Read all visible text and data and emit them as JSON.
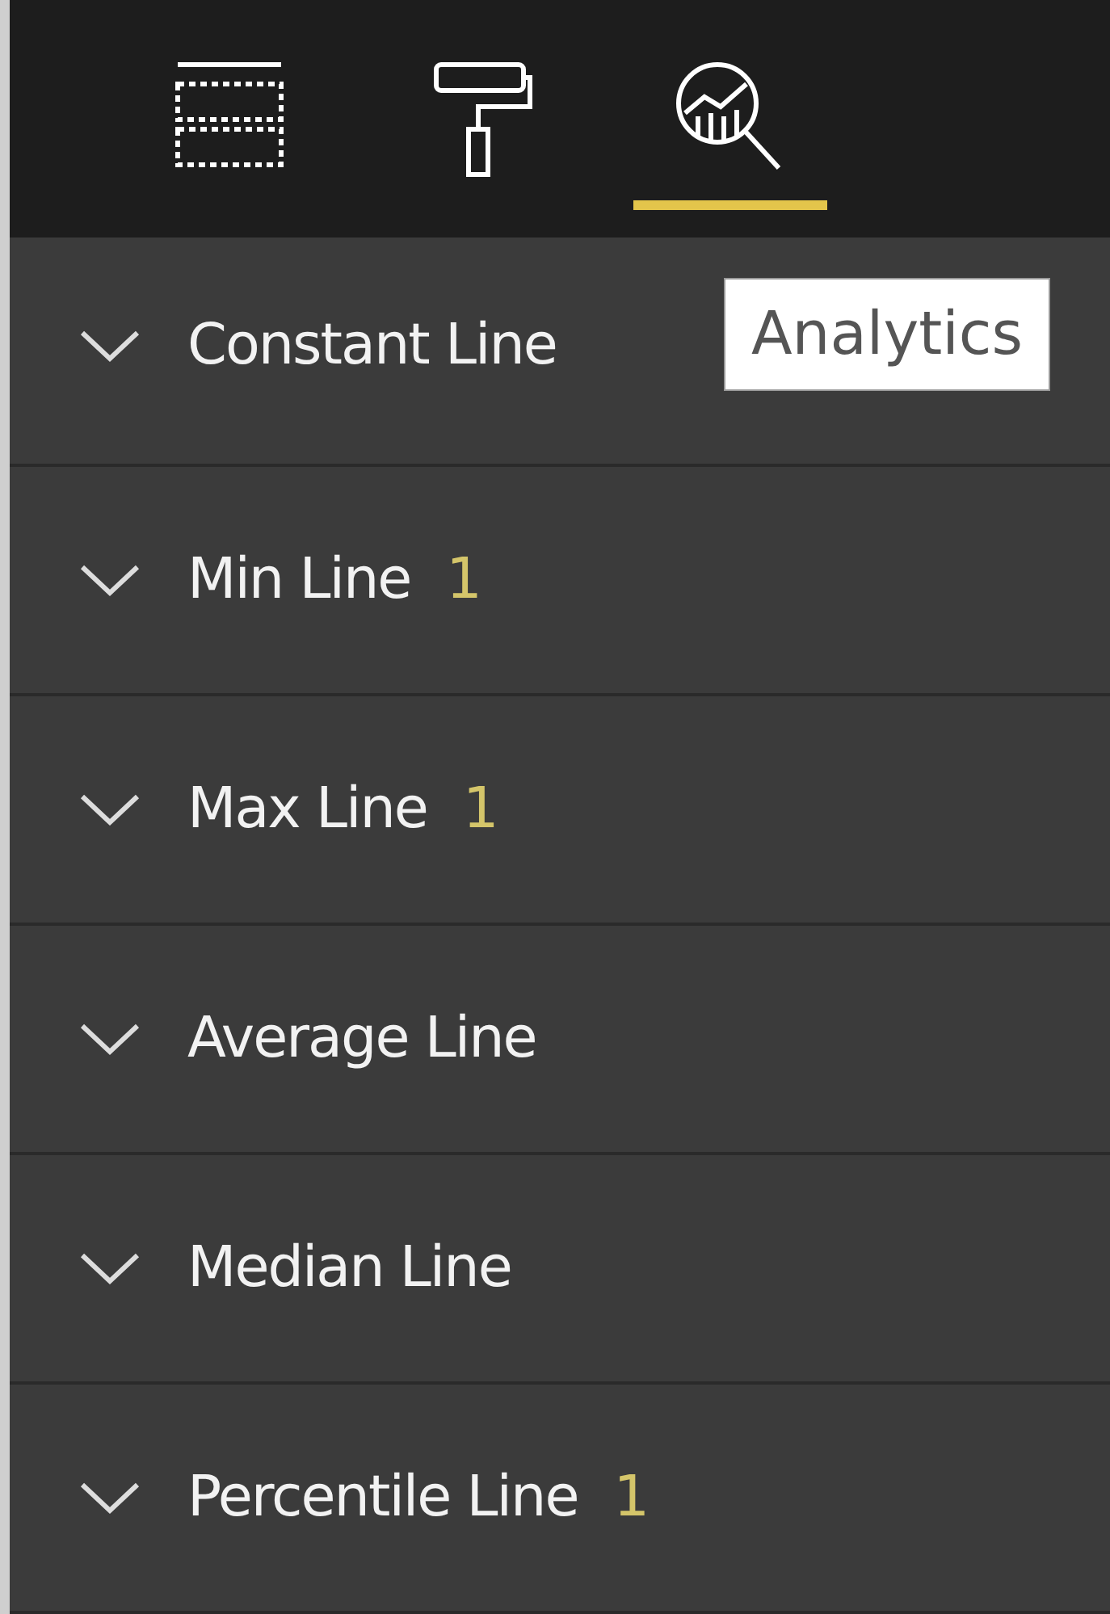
{
  "tabs": [
    {
      "kind": "fields",
      "selected": false
    },
    {
      "kind": "format",
      "selected": false
    },
    {
      "kind": "analytics",
      "selected": true
    }
  ],
  "tooltip": {
    "text": "Analytics"
  },
  "sections": [
    {
      "label": "Constant Line"
    },
    {
      "label": "Min Line",
      "count": "1"
    },
    {
      "label": "Max Line",
      "count": "1"
    },
    {
      "label": "Average Line"
    },
    {
      "label": "Median Line"
    },
    {
      "label": "Percentile Line",
      "count": "1"
    }
  ]
}
